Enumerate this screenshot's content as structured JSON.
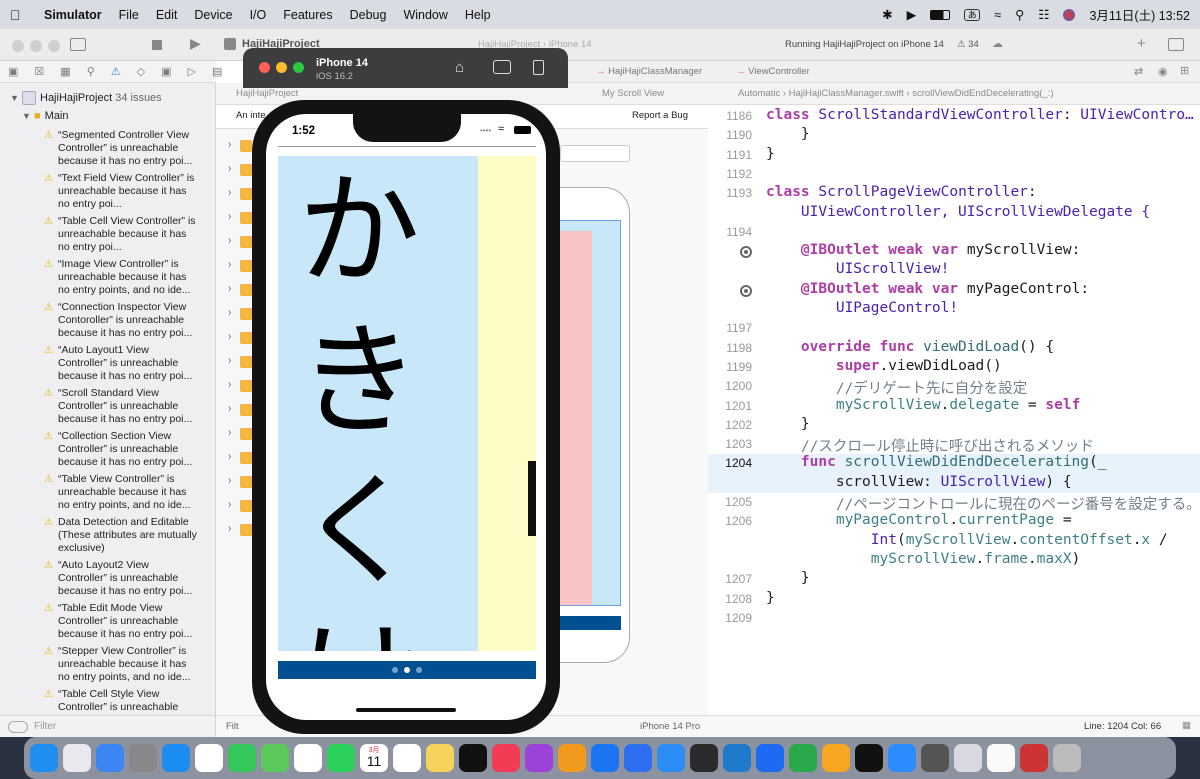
{
  "menubar": {
    "app_name": "Simulator",
    "items": [
      "File",
      "Edit",
      "Device",
      "I/O",
      "Features",
      "Debug",
      "Window",
      "Help"
    ],
    "ime": "あ",
    "datetime": "3月11日(土) 13:52"
  },
  "xcode": {
    "project_title": "HajiHajiProject",
    "status_text": "Running HajiHajiProject on iPhone 14",
    "issue_count": "34",
    "scheme": "HajiHajiProject",
    "scheme_device": "iPhone 14",
    "tabs": [
      "HajiHajiClassManager",
      "ViewController"
    ],
    "navigator": {
      "project": "HajiHajiProject",
      "issues_label": "34 issues",
      "group": "Main",
      "issues": [
        "“Segmented Controller View Controller” is unreachable because it has no entry poi...",
        "“Text Field View Controller” is unreachable because it has no entry poi...",
        "“Table Cell View Controller” is unreachable because it has no entry poi...",
        "“Image View Controller” is unreachable because it has no entry points, and no ide...",
        "“Connection Inspector View Contoroller” is unreachable because it has no entry poi...",
        "“Auto Layout1 View Controller” is unreachable because it has no entry poi...",
        "“Scroll Standard View Controller” is unreachable because it has no entry poi...",
        "“Collection Section View Controller” is unreachable because it has no entry poi...",
        "“Table View Controller” is unreachable because it has no entry points, and no ide...",
        "Data Detection and Editable (These attributes are mutually exclusive)",
        "“Auto Layout2 View Controller” is unreachable because it has no entry poi...",
        "“Table Edit Mode View Controller” is unreachable because it has no entry poi...",
        "“Stepper View Controller” is unreachable because it has no entry points, and no ide...",
        "“Table Cell Style View Controller” is unreachable"
      ],
      "filter_placeholder": "Filter"
    },
    "ib": {
      "crumb_left": "HajiHajiProject",
      "crumb_right": "My Scroll View",
      "interface_text": "An inte",
      "report_bug": "Report a Bug",
      "device_label": "iPhone 14 Pro",
      "filter_placeholder": "Filt"
    },
    "editor": {
      "crumb": "Automatic  ›  HajiHajiClassManager.swift  ›  scrollViewDidEndDecelerating(_:)",
      "cursor": "Line: 1204  Col: 66"
    }
  },
  "simulator": {
    "device": "iPhone 14",
    "os": "iOS 16.2",
    "time": "1:52",
    "page_text": "かきくけ",
    "page_index": 1,
    "page_count": 3
  },
  "code_lines": [
    {
      "num": "1186",
      "segs": [
        [
          "class ",
          "kw"
        ],
        [
          "ScrollStandardViewController",
          "ty"
        ],
        [
          ": ",
          "p"
        ],
        [
          "UIViewContro…",
          "ty"
        ]
      ]
    },
    {
      "num": "1190",
      "segs": [
        [
          "    }",
          "p"
        ]
      ]
    },
    {
      "num": "1191",
      "segs": [
        [
          "}",
          "p"
        ]
      ]
    },
    {
      "num": "1192",
      "segs": []
    },
    {
      "num": "1193",
      "segs": [
        [
          "class ",
          "kw"
        ],
        [
          "ScrollPageViewController",
          "ty"
        ],
        [
          ":",
          "p"
        ]
      ]
    },
    {
      "num": "",
      "segs": [
        [
          "    UIViewController, UIScrollViewDelegate {",
          "ty2"
        ]
      ]
    },
    {
      "num": "1194",
      "segs": []
    },
    {
      "num": "",
      "bp": true,
      "segs": [
        [
          "    ",
          "p"
        ],
        [
          "@IBOutlet",
          "kw2"
        ],
        [
          " weak var ",
          "kw"
        ],
        [
          "myScrollView",
          ""
        ],
        [
          ":",
          "p"
        ]
      ]
    },
    {
      "num": "",
      "segs": [
        [
          "        UIScrollView!",
          "ty2"
        ]
      ]
    },
    {
      "num": "",
      "bp": true,
      "segs": [
        [
          "    ",
          "p"
        ],
        [
          "@IBOutlet",
          "kw2"
        ],
        [
          " weak var ",
          "kw"
        ],
        [
          "myPageControl",
          ""
        ],
        [
          ":",
          "p"
        ]
      ]
    },
    {
      "num": "",
      "segs": [
        [
          "        UIPageControl!",
          "ty2"
        ]
      ]
    },
    {
      "num": "1197",
      "segs": []
    },
    {
      "num": "1198",
      "segs": [
        [
          "    override func ",
          "kw"
        ],
        [
          "viewDidLoad",
          "fn"
        ],
        [
          "() {",
          "p"
        ]
      ]
    },
    {
      "num": "1199",
      "segs": [
        [
          "        super",
          "kw"
        ],
        [
          ".viewDidLoad()",
          "p"
        ]
      ]
    },
    {
      "num": "1200",
      "segs": [
        [
          "        //デリゲート先に自分を設定",
          "cm"
        ]
      ]
    },
    {
      "num": "1201",
      "segs": [
        [
          "        myScrollView",
          "id"
        ],
        [
          ".",
          "p"
        ],
        [
          "delegate",
          "id"
        ],
        [
          " = ",
          "p"
        ],
        [
          "self",
          "kw"
        ]
      ]
    },
    {
      "num": "1202",
      "segs": [
        [
          "    }",
          "p"
        ]
      ]
    },
    {
      "num": "1203",
      "segs": [
        [
          "    //スクロール停止時に呼び出されるメソッド",
          "cm"
        ]
      ]
    },
    {
      "num": "1204",
      "hl": true,
      "segs": [
        [
          "    func ",
          "kw"
        ],
        [
          "scrollViewDidEndDecelerating",
          "fn"
        ],
        [
          "(_",
          "p"
        ]
      ]
    },
    {
      "num": "",
      "hl": true,
      "segs": [
        [
          "        scrollView: ",
          "p"
        ],
        [
          "UIScrollView",
          "ty"
        ],
        [
          ") {",
          "p"
        ]
      ]
    },
    {
      "num": "1205",
      "segs": [
        [
          "        //ページコントロールに現在のページ番号を設定する。",
          "cm"
        ]
      ]
    },
    {
      "num": "1206",
      "segs": [
        [
          "        myPageControl",
          "id"
        ],
        [
          ".",
          "p"
        ],
        [
          "currentPage",
          "id"
        ],
        [
          " =",
          "p"
        ]
      ]
    },
    {
      "num": "",
      "segs": [
        [
          "            Int",
          "ty"
        ],
        [
          "(",
          "p"
        ],
        [
          "myScrollView",
          "id"
        ],
        [
          ".",
          "p"
        ],
        [
          "contentOffset",
          "id"
        ],
        [
          ".",
          "p"
        ],
        [
          "x",
          "id"
        ],
        [
          " /",
          "p"
        ]
      ]
    },
    {
      "num": "",
      "segs": [
        [
          "            myScrollView",
          "id"
        ],
        [
          ".",
          "p"
        ],
        [
          "frame",
          "id"
        ],
        [
          ".",
          "p"
        ],
        [
          "maxX",
          "id"
        ],
        [
          ")",
          "p"
        ]
      ]
    },
    {
      "num": "1207",
      "segs": [
        [
          "    }",
          "p"
        ]
      ]
    },
    {
      "num": "1208",
      "segs": [
        [
          "}",
          "p"
        ]
      ]
    },
    {
      "num": "1209",
      "segs": []
    }
  ],
  "colors": {
    "keyword": "#ad3da4",
    "type": "#4b21b0",
    "comment": "#707f8c",
    "identifier": "#3e8087",
    "function": "#326d74",
    "scroll_page_bg": "#c8e8fa",
    "scroll_page2_bg": "#fffcc8",
    "page_control_bg": "#004f91"
  },
  "dock_apps": [
    "finder-icon",
    "launchpad-icon",
    "mail-icon",
    "system-settings-icon",
    "safari-icon",
    "chrome-icon",
    "messages-icon",
    "maps-icon",
    "photos-icon",
    "facetime-icon",
    "calendar-icon",
    "reminders-icon",
    "notes-icon",
    "tv-icon",
    "music-icon",
    "podcasts-icon",
    "books-icon",
    "xcode-icon",
    "simulator-icon",
    "appstore-icon",
    "mail2-icon",
    "vscode-icon",
    "keynote-icon",
    "numbers-icon",
    "pages-icon",
    "terminal-icon",
    "zoom-icon",
    "calculator-icon",
    "preview-icon",
    "textedit-icon",
    "ime-icon",
    "trash-icon"
  ],
  "dock_calendar": {
    "month": "3月",
    "day": "11"
  }
}
